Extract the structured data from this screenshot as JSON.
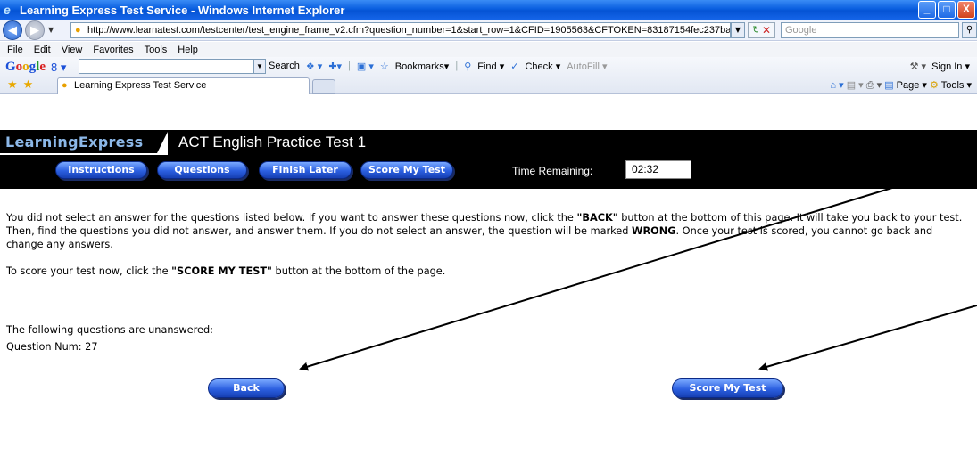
{
  "window": {
    "title": "Learning Express Test Service - Windows Internet Explorer",
    "controls": [
      "_",
      "□",
      "X"
    ]
  },
  "address_bar": {
    "url": "http://www.learnatest.com/testcenter/test_engine_frame_v2.cfm?question_number=1&start_row=1&CFID=1905563&CFTOKEN=83187154fec237ba",
    "search_placeholder": "Google"
  },
  "menu": [
    "File",
    "Edit",
    "View",
    "Favorites",
    "Tools",
    "Help"
  ],
  "google_toolbar": {
    "logo": [
      "G",
      "o",
      "o",
      "g",
      "l",
      "e"
    ],
    "profile": "8 ▾",
    "items": [
      "Search",
      "Bookmarks▾",
      "Find ▾",
      "Check ▾",
      "AutoFill ▾"
    ],
    "sign_in": "Sign In ▾"
  },
  "tabs": {
    "active_tab": "Learning Express Test Service"
  },
  "command_bar": {
    "page": "Page ▾",
    "tools": "Tools ▾"
  },
  "app": {
    "brand": "LearningExpress",
    "test_title": "ACT English Practice Test 1",
    "nav": {
      "instructions": "Instructions",
      "questions": "Questions",
      "finish_later": "Finish Later",
      "score_my_test": "Score My Test"
    },
    "time_label": "Time Remaining:",
    "time_value": "02:32"
  },
  "content": {
    "para1_a": "You did not select an answer for the questions listed below. If you want to answer these questions now, click the ",
    "para1_back": "\"BACK\"",
    "para1_b": " button at the bottom of this page. It will take you back to your test. Then, find the questions you did not answer, and answer them. If you do not select an answer, the question will be marked ",
    "para1_wrong": "WRONG",
    "para1_c": ". Once your test is scored, you cannot go back and change any answers.",
    "para2_a": "To score your test now, click the ",
    "para2_score": "\"SCORE MY TEST\"",
    "para2_b": " button at the bottom of the page.",
    "unanswered_heading": "The following questions are unanswered:",
    "question_num": "Question Num: 27",
    "back_button": "Back",
    "score_button": "Score My Test"
  }
}
